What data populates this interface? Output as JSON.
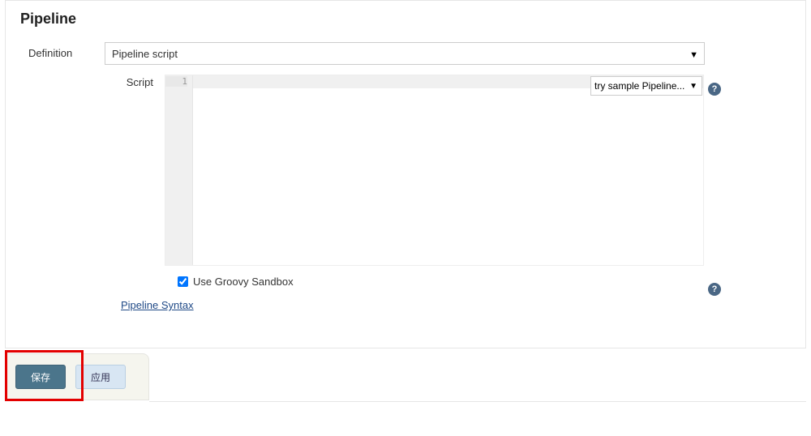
{
  "section": {
    "title": "Pipeline"
  },
  "definition": {
    "label": "Definition",
    "selected": "Pipeline script"
  },
  "script": {
    "label": "Script",
    "line_number": "1",
    "sample_selected": "try sample Pipeline..."
  },
  "sandbox": {
    "checked": true,
    "label": "Use Groovy Sandbox"
  },
  "links": {
    "pipeline_syntax": "Pipeline Syntax"
  },
  "help": {
    "glyph": "?"
  },
  "buttons": {
    "save": "保存",
    "apply": "应用"
  }
}
